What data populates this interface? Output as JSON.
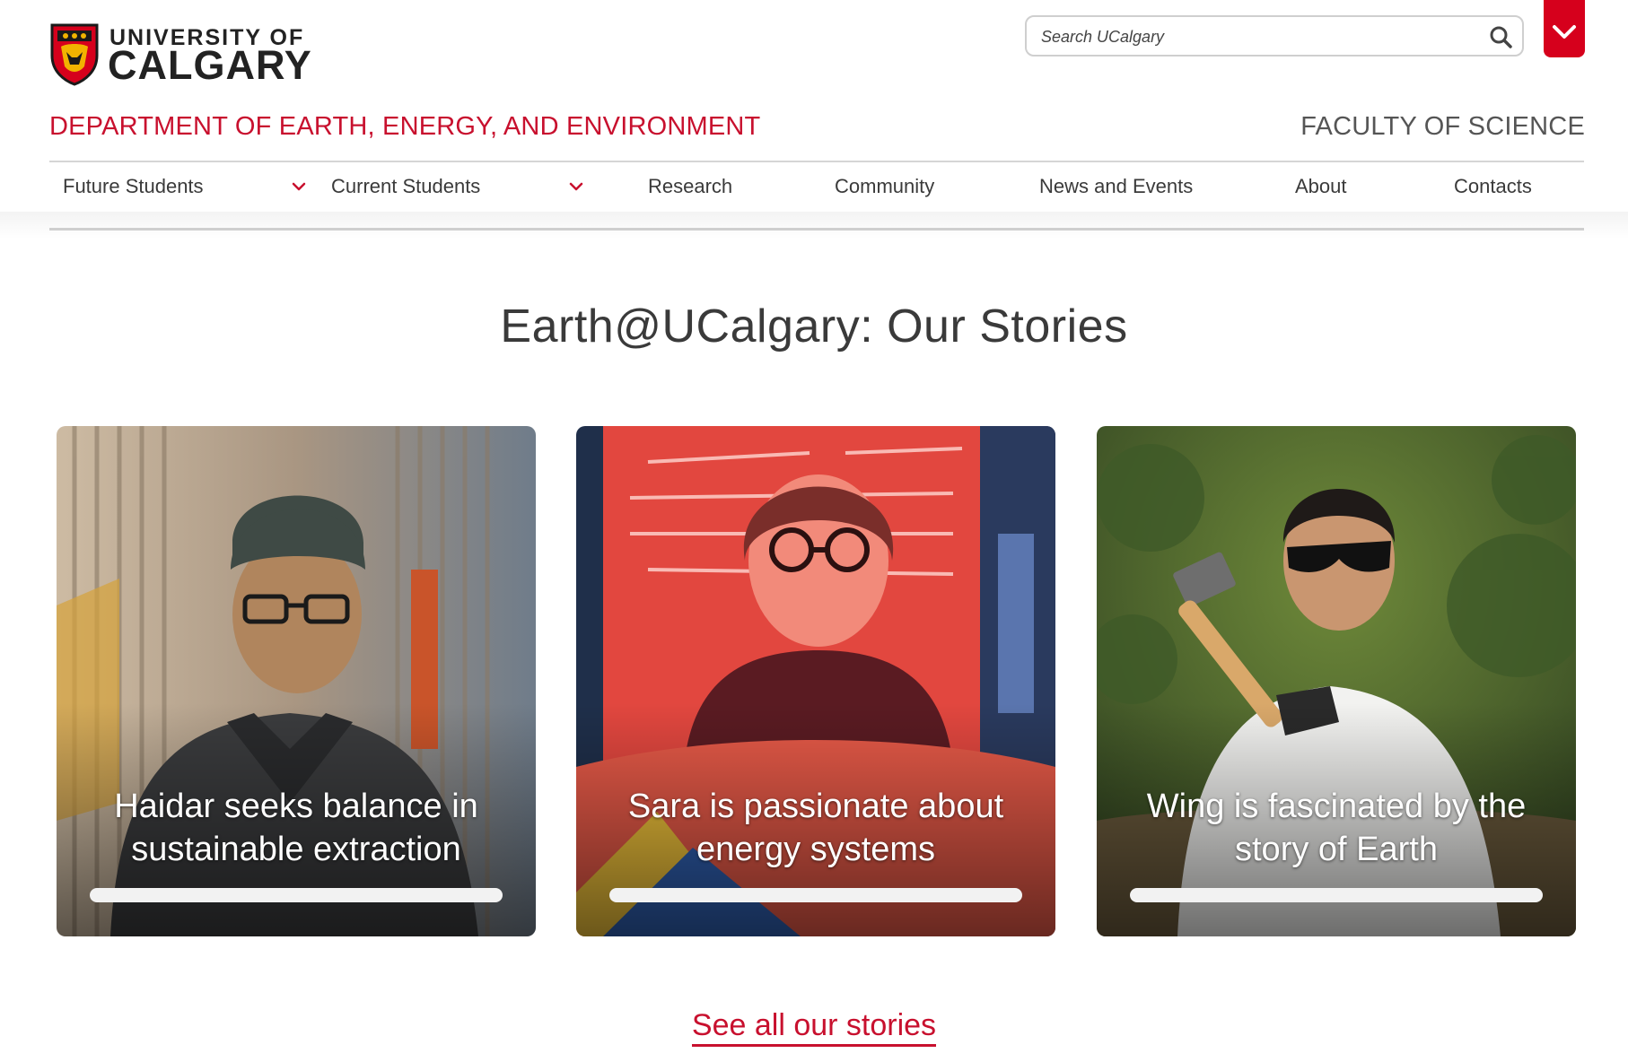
{
  "brand": {
    "line1": "UNIVERSITY OF",
    "line2": "CALGARY",
    "shield_icon": "university-crest-icon"
  },
  "search": {
    "placeholder": "Search UCalgary",
    "icon": "search-icon"
  },
  "menu_toggle_icon": "chevron-down-icon",
  "department": "DEPARTMENT OF EARTH, ENERGY, AND ENVIRONMENT",
  "faculty": "FACULTY OF SCIENCE",
  "nav": {
    "items": [
      {
        "label": "Future Students",
        "has_dropdown": true
      },
      {
        "label": "Current Students",
        "has_dropdown": true
      },
      {
        "label": "Research"
      },
      {
        "label": "Community"
      },
      {
        "label": "News and Events"
      },
      {
        "label": "About"
      },
      {
        "label": "Contacts"
      }
    ]
  },
  "section": {
    "title": "Earth@UCalgary: Our Stories"
  },
  "cards": [
    {
      "caption": "Haidar seeks balance in sustainable extraction"
    },
    {
      "caption": "Sara is passionate about energy systems"
    },
    {
      "caption": "Wing is fascinated by the story of Earth"
    }
  ],
  "see_all": "See all our stories",
  "colors": {
    "brand_red": "#c8102e",
    "menu_red": "#d6001c",
    "text": "#3a3a3a"
  }
}
